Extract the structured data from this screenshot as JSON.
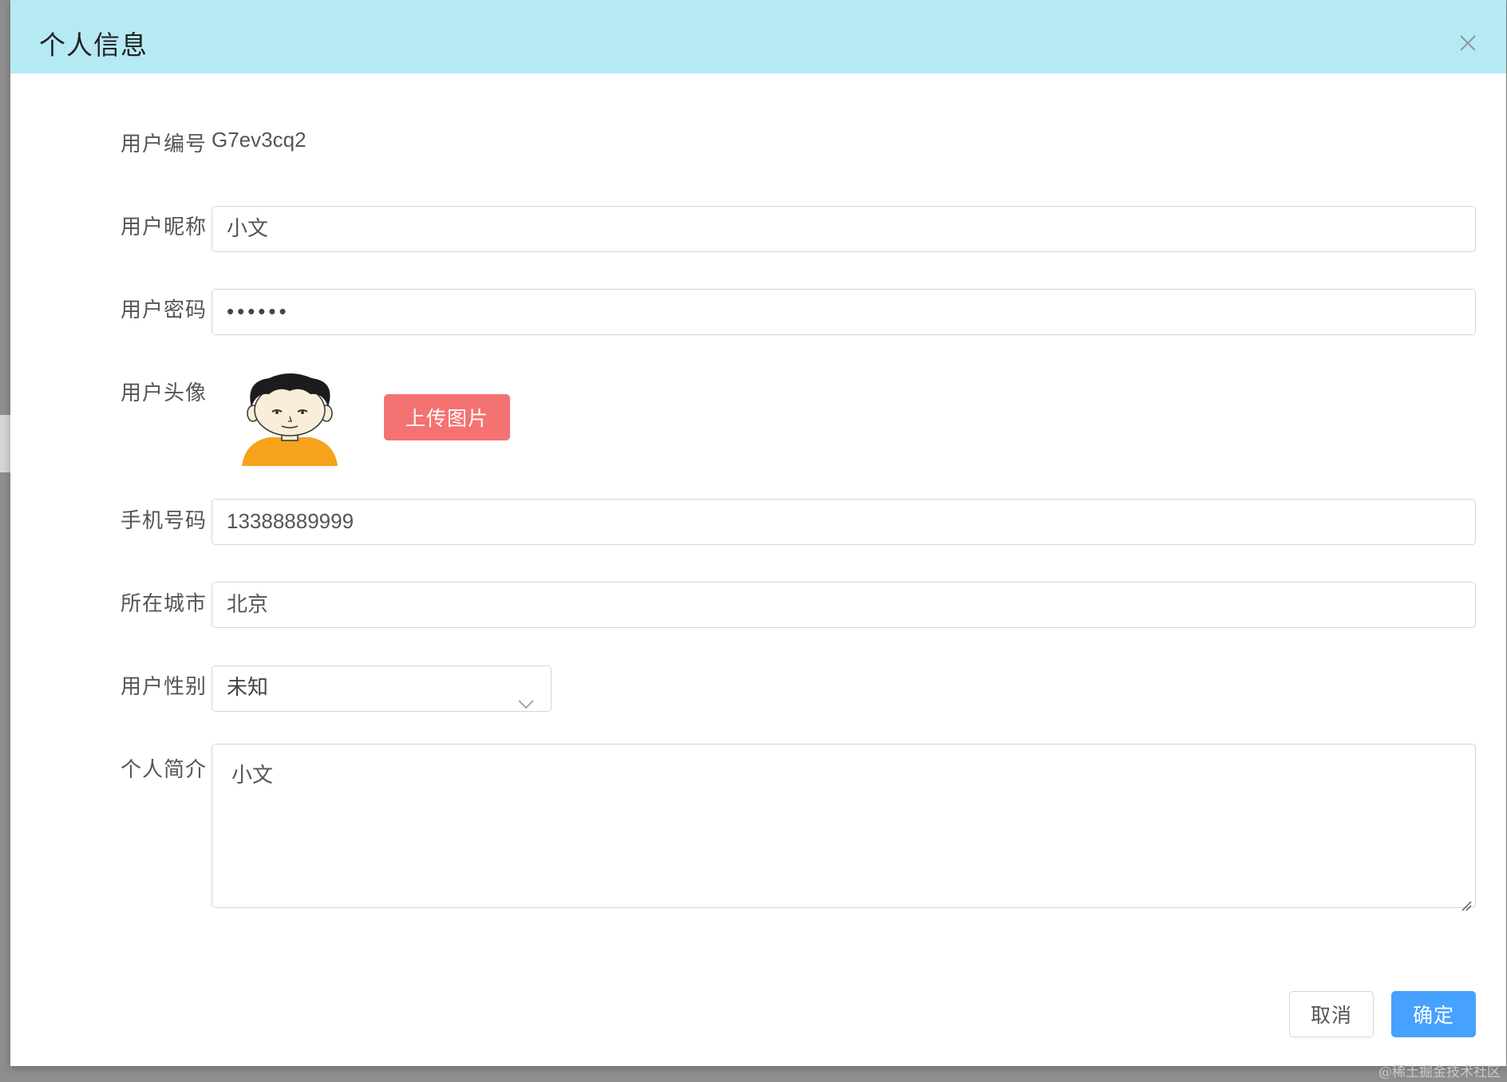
{
  "dialog": {
    "title": "个人信息"
  },
  "form": {
    "user_id": {
      "label": "用户编号",
      "value": "G7ev3cq2"
    },
    "nickname": {
      "label": "用户昵称",
      "value": "小文"
    },
    "password": {
      "label": "用户密码",
      "value": "••••••"
    },
    "avatar": {
      "label": "用户头像",
      "upload_label": "上传图片"
    },
    "phone": {
      "label": "手机号码",
      "value": "13388889999"
    },
    "city": {
      "label": "所在城市",
      "value": "北京"
    },
    "gender": {
      "label": "用户性别",
      "value": "未知"
    },
    "bio": {
      "label": "个人简介",
      "value": "小文"
    }
  },
  "footer": {
    "cancel_label": "取消",
    "confirm_label": "确定"
  },
  "watermark": "@稀土掘金技术社区",
  "colors": {
    "header_bg": "#b5eaf5",
    "upload_button": "#f47272",
    "confirm_button": "#46a1ff"
  }
}
